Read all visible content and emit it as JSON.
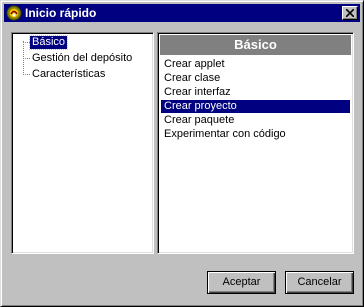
{
  "dialog": {
    "title": "Inicio rápido",
    "close_icon": "close-icon",
    "app_icon": "java-app-icon"
  },
  "tree": {
    "items": [
      {
        "label": "Básico",
        "selected": true
      },
      {
        "label": "Gestión del depósito",
        "selected": false
      },
      {
        "label": "Características",
        "selected": false
      }
    ]
  },
  "list": {
    "header": "Básico",
    "items": [
      {
        "label": "Crear applet",
        "selected": false
      },
      {
        "label": "Crear clase",
        "selected": false
      },
      {
        "label": "Crear interfaz",
        "selected": false
      },
      {
        "label": "Crear proyecto",
        "selected": true
      },
      {
        "label": "Crear paquete",
        "selected": false
      },
      {
        "label": "Experimentar con código",
        "selected": false
      }
    ]
  },
  "buttons": {
    "accept_label": "Aceptar",
    "cancel_label": "Cancelar"
  },
  "colors": {
    "titlebar": "#000080",
    "selection": "#000080",
    "face": "#c0c0c0",
    "header": "#808080"
  }
}
